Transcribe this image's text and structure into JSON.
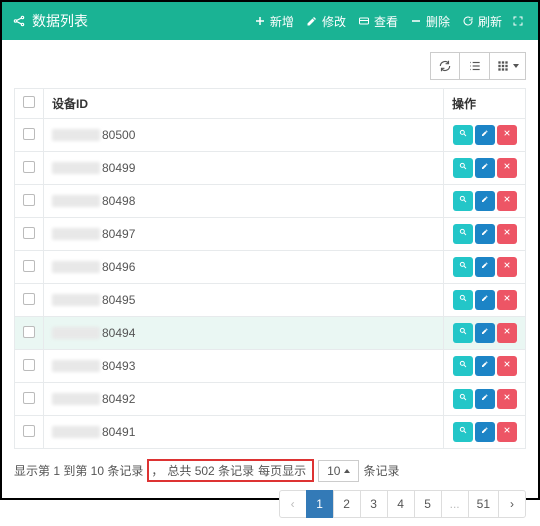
{
  "header": {
    "title": "数据列表",
    "buttons": {
      "add": "新增",
      "edit": "修改",
      "view": "查看",
      "delete": "删除",
      "refresh": "刷新"
    }
  },
  "table": {
    "columns": {
      "id": "设备ID",
      "ops": "操作"
    },
    "rows": [
      {
        "id_suffix": "80500"
      },
      {
        "id_suffix": "80499"
      },
      {
        "id_suffix": "80498"
      },
      {
        "id_suffix": "80497"
      },
      {
        "id_suffix": "80496"
      },
      {
        "id_suffix": "80495"
      },
      {
        "id_suffix": "80494",
        "highlight": true
      },
      {
        "id_suffix": "80493"
      },
      {
        "id_suffix": "80492"
      },
      {
        "id_suffix": "80491"
      }
    ]
  },
  "footer": {
    "info_prefix": "显示第 1 到第 10 条记录",
    "info_sep": "，",
    "info_total": "总共 502 条记录",
    "info_per_prefix": " 每页显示",
    "info_per_suffix": "条记录",
    "page_size": "10",
    "pagination": {
      "prev": "‹",
      "next": "›",
      "pages": [
        "1",
        "2",
        "3",
        "4",
        "5",
        "...",
        "51"
      ],
      "active": "1"
    }
  }
}
